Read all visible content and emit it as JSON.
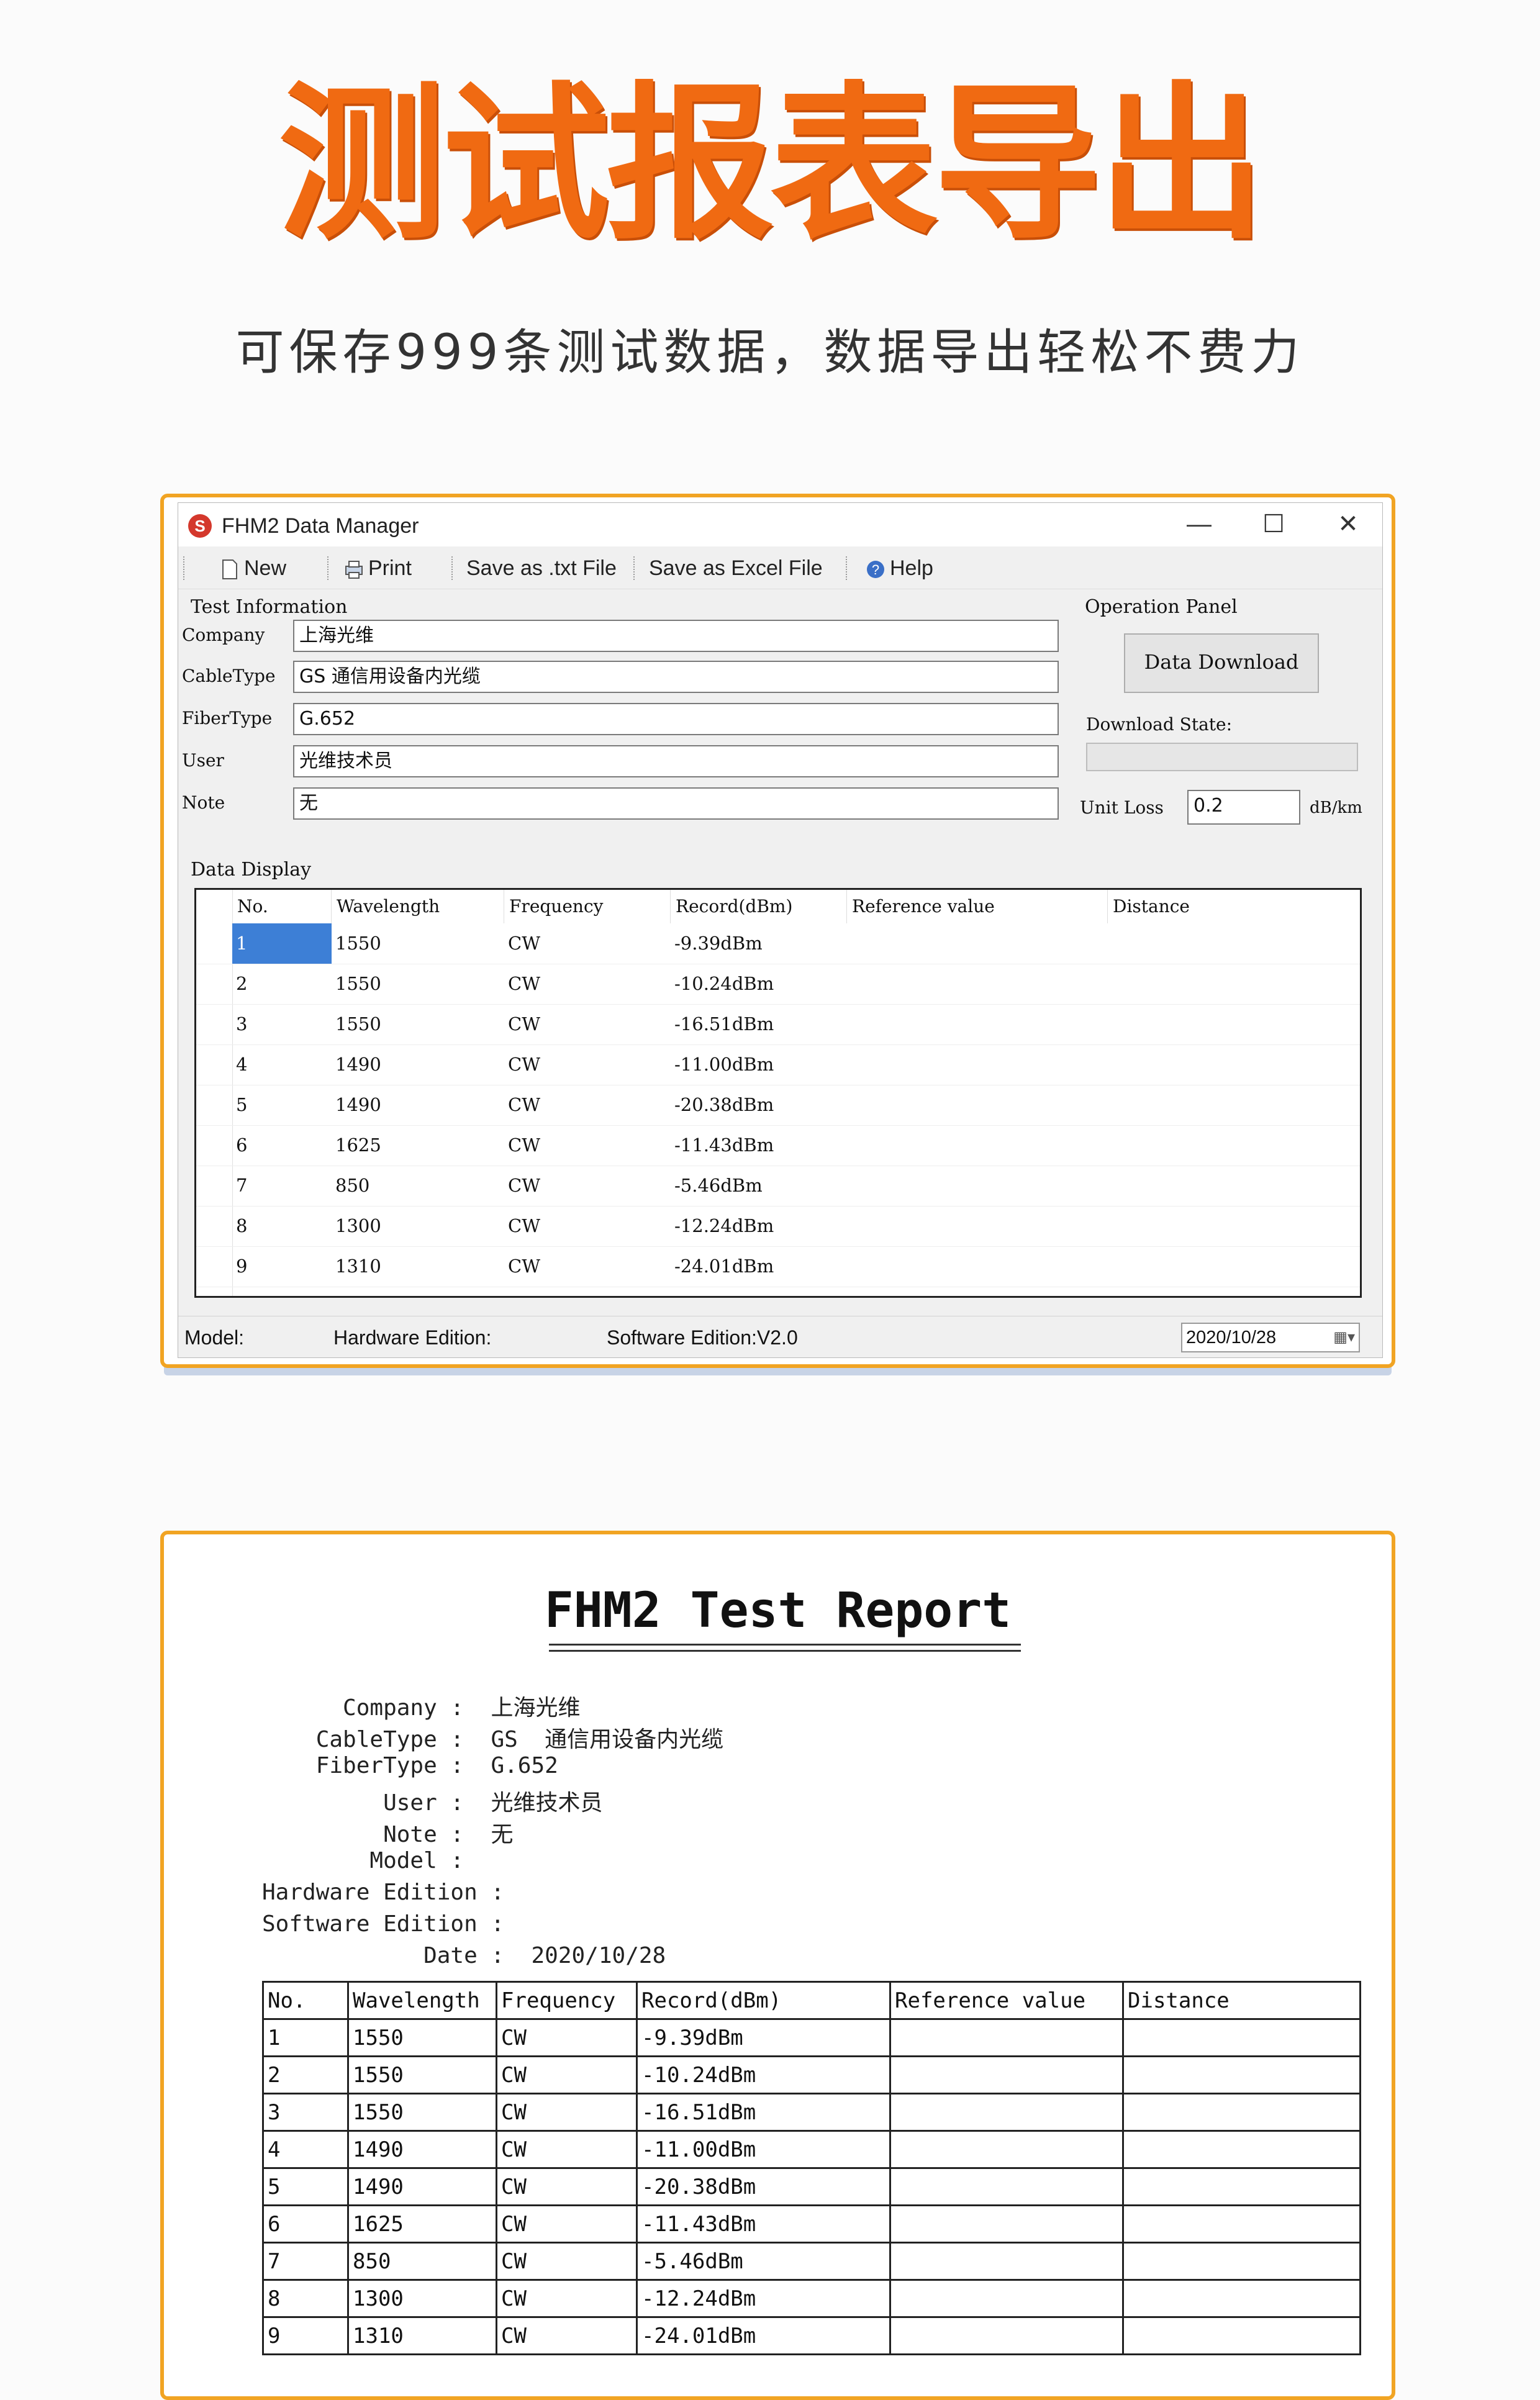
{
  "headline": "测试报表导出",
  "subline": "可保存999条测试数据，数据导出轻松不费力",
  "app": {
    "title": "FHM2 Data Manager",
    "controls": {
      "minimize": "—",
      "maximize": "☐",
      "close": "✕"
    },
    "toolbar": {
      "new": "New",
      "print": "Print",
      "save_txt": "Save as .txt File",
      "save_excel": "Save as Excel File",
      "help": "Help"
    },
    "test_info": {
      "title": "Test Information",
      "fields": [
        {
          "label": "Company",
          "value": "上海光维"
        },
        {
          "label": "CableType",
          "value": "GS 通信用设备内光缆"
        },
        {
          "label": "FiberType",
          "value": "G.652"
        },
        {
          "label": "User",
          "value": "光维技术员"
        },
        {
          "label": "Note",
          "value": "无"
        }
      ]
    },
    "operation_panel": {
      "title": "Operation Panel",
      "download_button": "Data Download",
      "download_state_label": "Download State:",
      "unit_loss_label": "Unit Loss",
      "unit_loss_value": "0.2",
      "unit_loss_unit": "dB/km"
    },
    "data_display": {
      "title": "Data Display",
      "columns": [
        "No.",
        "Wavelength",
        "Frequency",
        "Record(dBm)",
        "Reference value",
        "Distance"
      ],
      "rows": [
        [
          "1",
          "1550",
          "CW",
          "-9.39dBm",
          "",
          ""
        ],
        [
          "2",
          "1550",
          "CW",
          "-10.24dBm",
          "",
          ""
        ],
        [
          "3",
          "1550",
          "CW",
          "-16.51dBm",
          "",
          ""
        ],
        [
          "4",
          "1490",
          "CW",
          "-11.00dBm",
          "",
          ""
        ],
        [
          "5",
          "1490",
          "CW",
          "-20.38dBm",
          "",
          ""
        ],
        [
          "6",
          "1625",
          "CW",
          "-11.43dBm",
          "",
          ""
        ],
        [
          "7",
          "850",
          "CW",
          "-5.46dBm",
          "",
          ""
        ],
        [
          "8",
          "1300",
          "CW",
          "-12.24dBm",
          "",
          ""
        ],
        [
          "9",
          "1310",
          "CW",
          "-24.01dBm",
          "",
          ""
        ]
      ]
    },
    "status": {
      "model": "Model:",
      "hardware": "Hardware Edition:",
      "software": "Software Edition:V2.0",
      "date": "2020/10/28"
    }
  },
  "report": {
    "title": "FHM2  Test  Report",
    "info": [
      "      Company :  上海光维",
      "    CableType :  GS  通信用设备内光缆",
      "    FiberType :  G.652",
      "         User :  光维技术员",
      "         Note :  无",
      "        Model :",
      "Hardware Edition :",
      "Software Edition :",
      "            Date :  2020/10/28"
    ],
    "columns": [
      "No.",
      "Wavelength",
      "Frequency",
      "Record(dBm)",
      "Reference value",
      "Distance"
    ],
    "rows": [
      [
        "1",
        "1550",
        "CW",
        "-9.39dBm",
        "",
        ""
      ],
      [
        "2",
        "1550",
        "CW",
        "-10.24dBm",
        "",
        ""
      ],
      [
        "3",
        "1550",
        "CW",
        "-16.51dBm",
        "",
        ""
      ],
      [
        "4",
        "1490",
        "CW",
        "-11.00dBm",
        "",
        ""
      ],
      [
        "5",
        "1490",
        "CW",
        "-20.38dBm",
        "",
        ""
      ],
      [
        "6",
        "1625",
        "CW",
        "-11.43dBm",
        "",
        ""
      ],
      [
        "7",
        "850",
        "CW",
        "-5.46dBm",
        "",
        ""
      ],
      [
        "8",
        "1300",
        "CW",
        "-12.24dBm",
        "",
        ""
      ],
      [
        "9",
        "1310",
        "CW",
        "-24.01dBm",
        "",
        ""
      ]
    ]
  }
}
